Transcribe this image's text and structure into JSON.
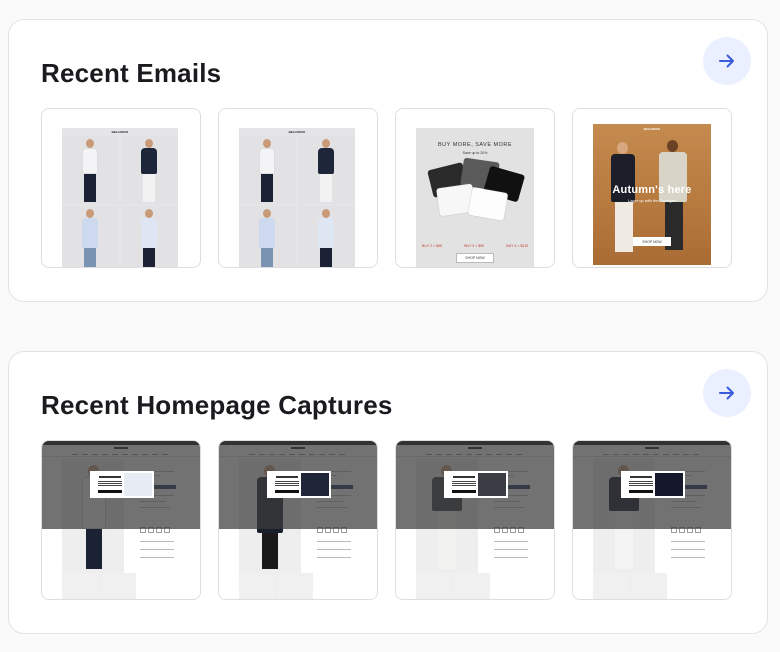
{
  "sections": [
    {
      "title": "Recent Emails",
      "arrow_icon": "arrow-right-icon",
      "thumbnails": [
        {
          "kind": "email-grid",
          "brand": "BELLROCK"
        },
        {
          "kind": "email-grid",
          "brand": "BELLROCK"
        },
        {
          "kind": "email-tees",
          "headline": "BUY MORE, SAVE MORE",
          "subhead": "Save up to 20%",
          "prices": [
            "BUY 2 = $65",
            "BUY 3 = $90",
            "BUY 4 = $115"
          ],
          "button": "SHOP NOW"
        },
        {
          "kind": "email-autumn",
          "brand": "BELLROCK",
          "headline": "Autumn's here",
          "subhead": "Layer up with the Cardigan",
          "button": "SHOP NOW"
        }
      ]
    },
    {
      "title": "Recent Homepage Captures",
      "arrow_icon": "arrow-right-icon",
      "thumbnails": [
        {
          "kind": "homepage",
          "popup_title": "Want a Surprise Discount?",
          "shirt": "white"
        },
        {
          "kind": "homepage",
          "popup_title": "Want a Surprise Discount?",
          "shirt": "navy"
        },
        {
          "kind": "homepage",
          "popup_title": "Want a Surprise Discount?",
          "shirt": "charcoal"
        },
        {
          "kind": "homepage",
          "popup_title": "Want a Surprise Discount?",
          "shirt": "black"
        }
      ]
    }
  ],
  "colors": {
    "accent": "#3a5bd9",
    "arrow_bg": "#eaf0ff",
    "card_border": "#e3e3e6"
  }
}
